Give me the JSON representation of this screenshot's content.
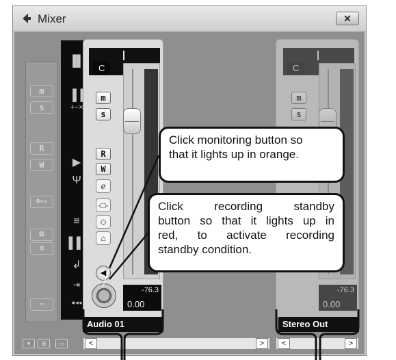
{
  "window": {
    "title": "Mixer",
    "close_label": "✕"
  },
  "left_strip": {
    "buttons": [
      "m",
      "s",
      "R",
      "W",
      "0<<"
    ]
  },
  "channels": [
    {
      "name": "Audio 01",
      "pan": "C",
      "buttons": {
        "mute": "m",
        "solo": "s",
        "read": "R",
        "write": "W",
        "edit": "e"
      },
      "peak": "-76.3",
      "volume": "0.00"
    },
    {
      "name": "Stereo Out",
      "pan": "C",
      "buttons": {
        "mute": "m",
        "solo": "s"
      },
      "peak": "-76.3",
      "volume": "0.00"
    }
  ],
  "callouts": {
    "monitor": [
      "Click monitoring button so",
      "that it lights up in orange."
    ],
    "record": [
      "Click recording standby",
      "button so that it lights up in",
      "red, to activate recording",
      "standby condition."
    ]
  },
  "colors": {
    "background": "#c9c9c9",
    "callout_border": "#111111"
  },
  "icons": [
    "mixer-icon",
    "close-icon",
    "monitor-speaker-icon",
    "record-button-icon",
    "scroll-left-icon",
    "scroll-right-icon"
  ]
}
